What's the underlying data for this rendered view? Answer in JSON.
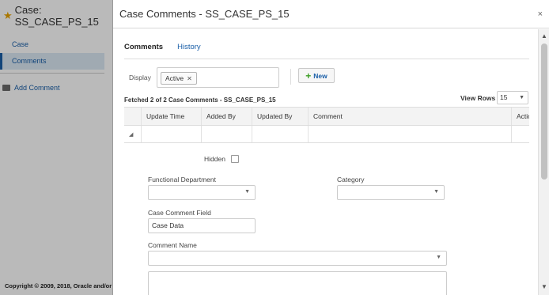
{
  "background": {
    "case_title": "Case: SS_CASE_PS_15",
    "nav_items": [
      "Case",
      "Comments"
    ],
    "add_comment": "Add Comment",
    "footer": "Copyright © 2009, 2018, Oracle and/or"
  },
  "modal": {
    "title": "Case Comments - SS_CASE_PS_15",
    "close": "×",
    "tabs": [
      "Comments",
      "History"
    ],
    "display_label": "Display",
    "display_chip": "Active",
    "new_button": "New",
    "fetched_text": "Fetched 2 of 2 Case Comments - SS_CASE_PS_15",
    "view_rows_label": "View Rows",
    "view_rows_value": "15",
    "columns": [
      "Update Time",
      "Added By",
      "Updated By",
      "Comment",
      "Actio"
    ],
    "detail": {
      "hidden_label": "Hidden",
      "functional_department_label": "Functional Department",
      "category_label": "Category",
      "case_comment_field_label": "Case Comment Field",
      "case_comment_field_value": "Case Data",
      "comment_name_label": "Comment Name"
    }
  },
  "colors": {
    "link": "#1a5fa8",
    "star": "#e8a400",
    "new_plus": "#3a9d23"
  }
}
